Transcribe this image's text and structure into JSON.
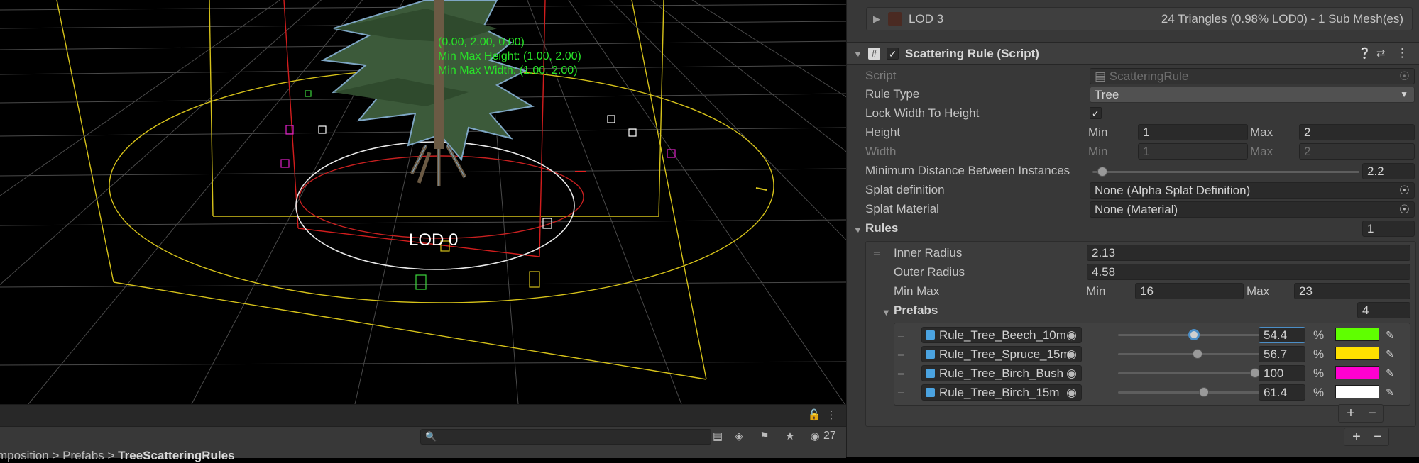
{
  "scene": {
    "gizmo_position": "(0.00, 2.00, 0.00)",
    "gizmo_height": "Min Max Height: (1.00, 2.00)",
    "gizmo_width": "Min Max Width: (1.00, 2.00)",
    "lod_label": "LOD 0"
  },
  "scene_toolbar": {
    "search_placeholder": "",
    "visible_count": "27"
  },
  "breadcrumb": {
    "part1": "mposition",
    "sep": ">",
    "part2": "Prefabs",
    "current": "TreeScatteringRules"
  },
  "lod3": {
    "label": "LOD 3",
    "info": "24 Triangles (0.98% LOD0) - 1 Sub Mesh(es)"
  },
  "component": {
    "title": "Scattering Rule (Script)",
    "script_label": "Script",
    "script_value": "ScatteringRule",
    "rule_type_label": "Rule Type",
    "rule_type_value": "Tree",
    "lock_label": "Lock Width To Height",
    "height_label": "Height",
    "height_min_label": "Min",
    "height_min": "1",
    "height_max_label": "Max",
    "height_max": "2",
    "width_label": "Width",
    "width_min_label": "Min",
    "width_min": "1",
    "width_max_label": "Max",
    "width_max": "2",
    "min_distance_label": "Minimum Distance Between Instances",
    "min_distance_value": "2.2",
    "min_distance_fraction": 0.02,
    "splat_def_label": "Splat definition",
    "splat_def_value": "None (Alpha Splat Definition)",
    "splat_mat_label": "Splat Material",
    "splat_mat_value": "None (Material)",
    "rules_label": "Rules",
    "rules_count": "1"
  },
  "rule0": {
    "inner_radius_label": "Inner Radius",
    "inner_radius": "2.13",
    "outer_radius_label": "Outer Radius",
    "outer_radius": "4.58",
    "minmax_label": "Min Max",
    "min_label": "Min",
    "min": "16",
    "max_label": "Max",
    "max": "23",
    "prefabs_label": "Prefabs",
    "prefabs_count": "4"
  },
  "prefabs": [
    {
      "name": "Rule_Tree_Beech_10m",
      "value": "54.4",
      "percent_sign": "%",
      "fraction": 0.544,
      "color": "#5fff00"
    },
    {
      "name": "Rule_Tree_Spruce_15m",
      "value": "56.7",
      "percent_sign": "%",
      "fraction": 0.567,
      "color": "#ffe000"
    },
    {
      "name": "Rule_Tree_Birch_Bush",
      "value": "100",
      "percent_sign": "%",
      "fraction": 1.0,
      "color": "#ff00d0"
    },
    {
      "name": "Rule_Tree_Birch_15m",
      "value": "61.4",
      "percent_sign": "%",
      "fraction": 0.614,
      "color": "#ffffff"
    }
  ],
  "icons": {
    "help": "question-icon",
    "presets": "sliders-icon",
    "menu": "kebab-icon",
    "picker": "eyedropper-icon"
  }
}
